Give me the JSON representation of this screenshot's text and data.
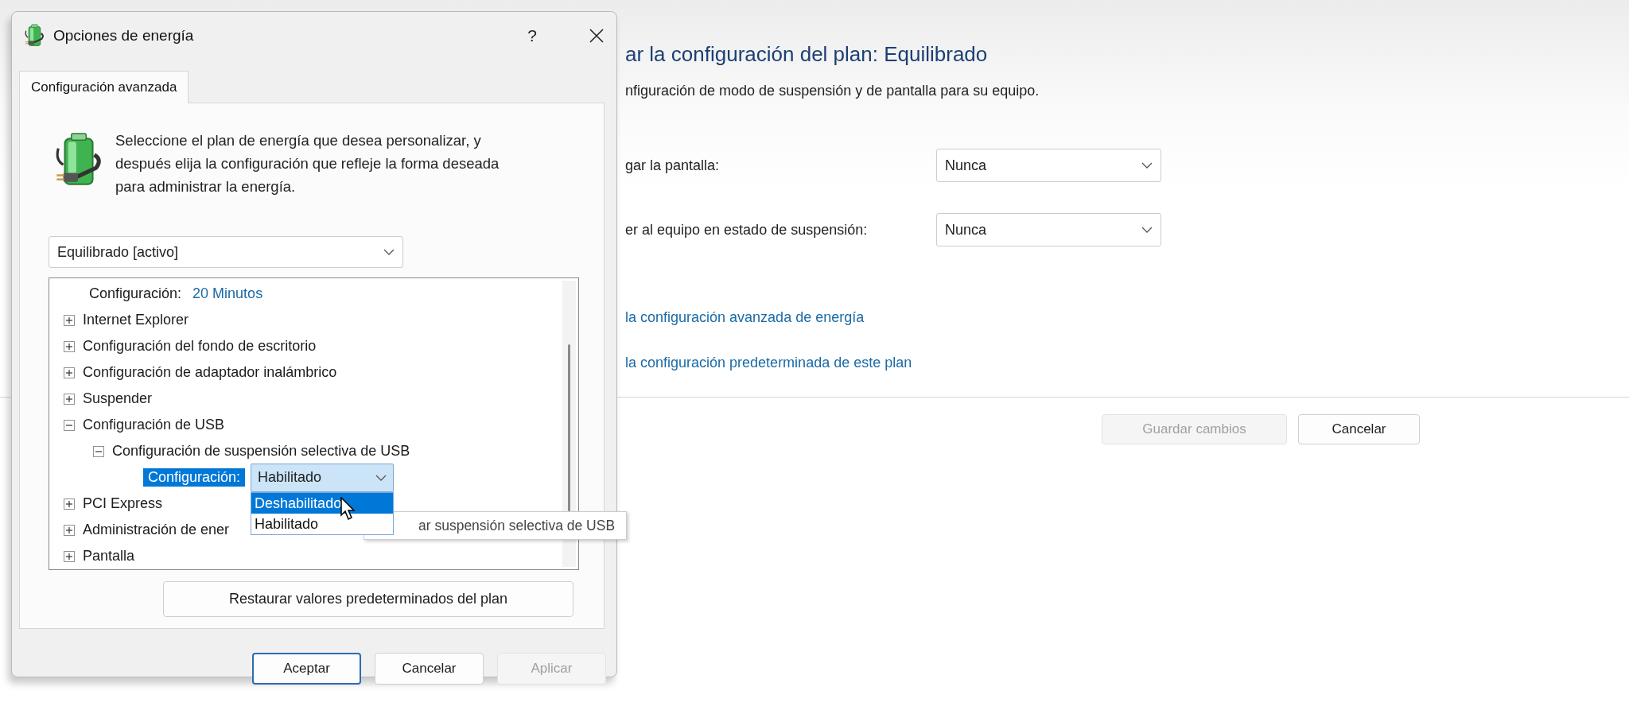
{
  "background_page": {
    "title": "ar la configuración del plan: Equilibrado",
    "subtitle": "nfiguración de modo de suspensión y de pantalla para su equipo.",
    "settings": [
      {
        "label": "gar la pantalla:",
        "value": "Nunca"
      },
      {
        "label": "er al equipo en estado de suspensión:",
        "value": "Nunca"
      }
    ],
    "links": [
      "la configuración avanzada de energía",
      "la configuración predeterminada de este plan"
    ],
    "buttons": [
      {
        "label": "Guardar cambios",
        "disabled": true
      },
      {
        "label": "Cancelar",
        "disabled": false
      }
    ]
  },
  "dialog": {
    "title": "Opciones de energía",
    "help": "?",
    "tabs": [
      {
        "label": "Configuración avanzada",
        "selected": true
      }
    ],
    "description": "Seleccione el plan de energía que desea personalizar, y después elija la configuración que refleje la forma deseada para administrar la energía.",
    "plan_select": "Equilibrado [activo]",
    "tree": [
      {
        "kind": "setting",
        "label": "Configuración:",
        "value": "20 Minutos",
        "selected": false
      },
      {
        "kind": "group",
        "label": "Internet Explorer",
        "expanded": false
      },
      {
        "kind": "group",
        "label": "Configuración del fondo de escritorio",
        "expanded": false
      },
      {
        "kind": "group",
        "label": "Configuración de adaptador inalámbrico",
        "expanded": false
      },
      {
        "kind": "group",
        "label": "Suspender",
        "expanded": false
      },
      {
        "kind": "group",
        "label": "Configuración de USB",
        "expanded": true,
        "children": [
          {
            "kind": "group",
            "label": "Configuración de suspensión selectiva de USB",
            "expanded": true,
            "children": [
              {
                "kind": "setting",
                "label": "Configuración:",
                "value": "Habilitado",
                "selected": true,
                "options": [
                  {
                    "label": "Deshabilitado",
                    "highlighted": true
                  },
                  {
                    "label": "Habilitado",
                    "highlighted": false
                  }
                ]
              }
            ]
          }
        ]
      },
      {
        "kind": "group",
        "label": "PCI Express",
        "expanded": false
      },
      {
        "kind": "group",
        "label": "Administración de ener",
        "expanded": false
      },
      {
        "kind": "group",
        "label": "Pantalla",
        "expanded": false
      }
    ],
    "tooltip": "ar suspensión selectiva de USB",
    "restore_button": "Restaurar valores predeterminados del plan",
    "buttons": [
      {
        "label": "Aceptar",
        "default": true,
        "disabled": false
      },
      {
        "label": "Cancelar",
        "default": false,
        "disabled": false
      },
      {
        "label": "Aplicar",
        "default": false,
        "disabled": true
      }
    ]
  }
}
